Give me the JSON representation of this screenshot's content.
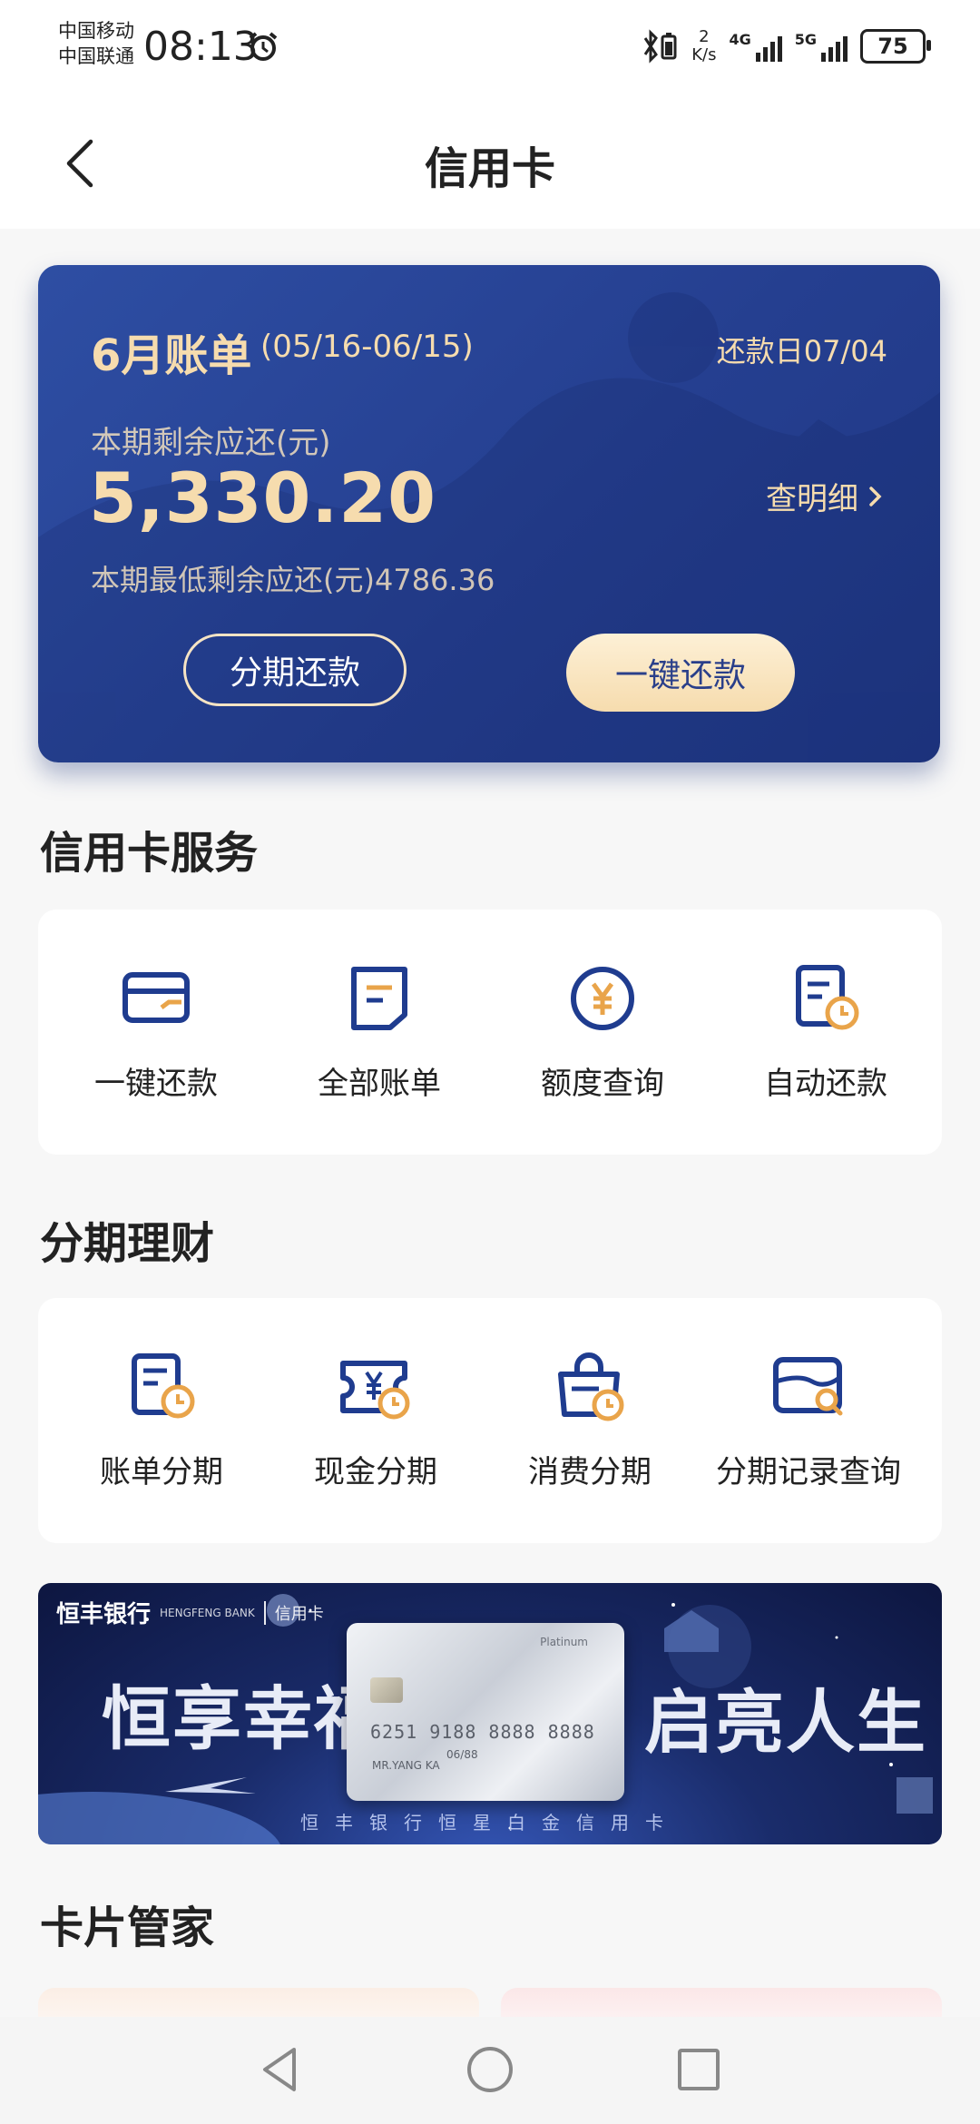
{
  "status_bar": {
    "carrier_1": "中国移动",
    "carrier_2": "中国联通",
    "time": "08:13",
    "net_speed_value": "2",
    "net_speed_unit": "K/s",
    "signal_1": "4G",
    "signal_2": "5G",
    "battery": "75"
  },
  "header": {
    "title": "信用卡"
  },
  "bill": {
    "month": "6月账单",
    "period": "(05/16-06/15)",
    "due_date": "还款日07/04",
    "remaining_label": "本期剩余应还(元)",
    "remaining_amount": "5,330.20",
    "detail_link": "查明细",
    "min_label": "本期最低剩余应还(元)4786.36",
    "installment_button": "分期还款",
    "pay_button": "一键还款"
  },
  "services": {
    "title": "信用卡服务",
    "items": [
      {
        "label": "一键还款",
        "icon": "card-pay-icon"
      },
      {
        "label": "全部账单",
        "icon": "bill-icon"
      },
      {
        "label": "额度查询",
        "icon": "yuan-circle-icon"
      },
      {
        "label": "自动还款",
        "icon": "auto-pay-icon"
      }
    ]
  },
  "installments": {
    "title": "分期理财",
    "items": [
      {
        "label": "账单分期",
        "icon": "bill-installment-icon"
      },
      {
        "label": "现金分期",
        "icon": "cash-installment-icon"
      },
      {
        "label": "消费分期",
        "icon": "shopping-installment-icon"
      },
      {
        "label": "分期记录查询",
        "icon": "record-search-icon"
      }
    ]
  },
  "banner": {
    "bank_name": "恒丰银行",
    "bank_name_en": "HENGFENG BANK",
    "card_tag": "信用卡",
    "left_text": "恒享幸福",
    "right_text": "启亮人生",
    "caption": "恒丰银行恒星白金信用卡",
    "card_number": "6251 9188 8888 8888",
    "card_holder": "MR.YANG KA",
    "card_expiry": "06/88",
    "card_level": "Platinum"
  },
  "card_manager": {
    "title": "卡片管家"
  },
  "colors": {
    "primary_blue": "#253f90",
    "gold": "#f6dcae",
    "icon_blue": "#1f3c8f",
    "icon_accent": "#e9a44a"
  }
}
